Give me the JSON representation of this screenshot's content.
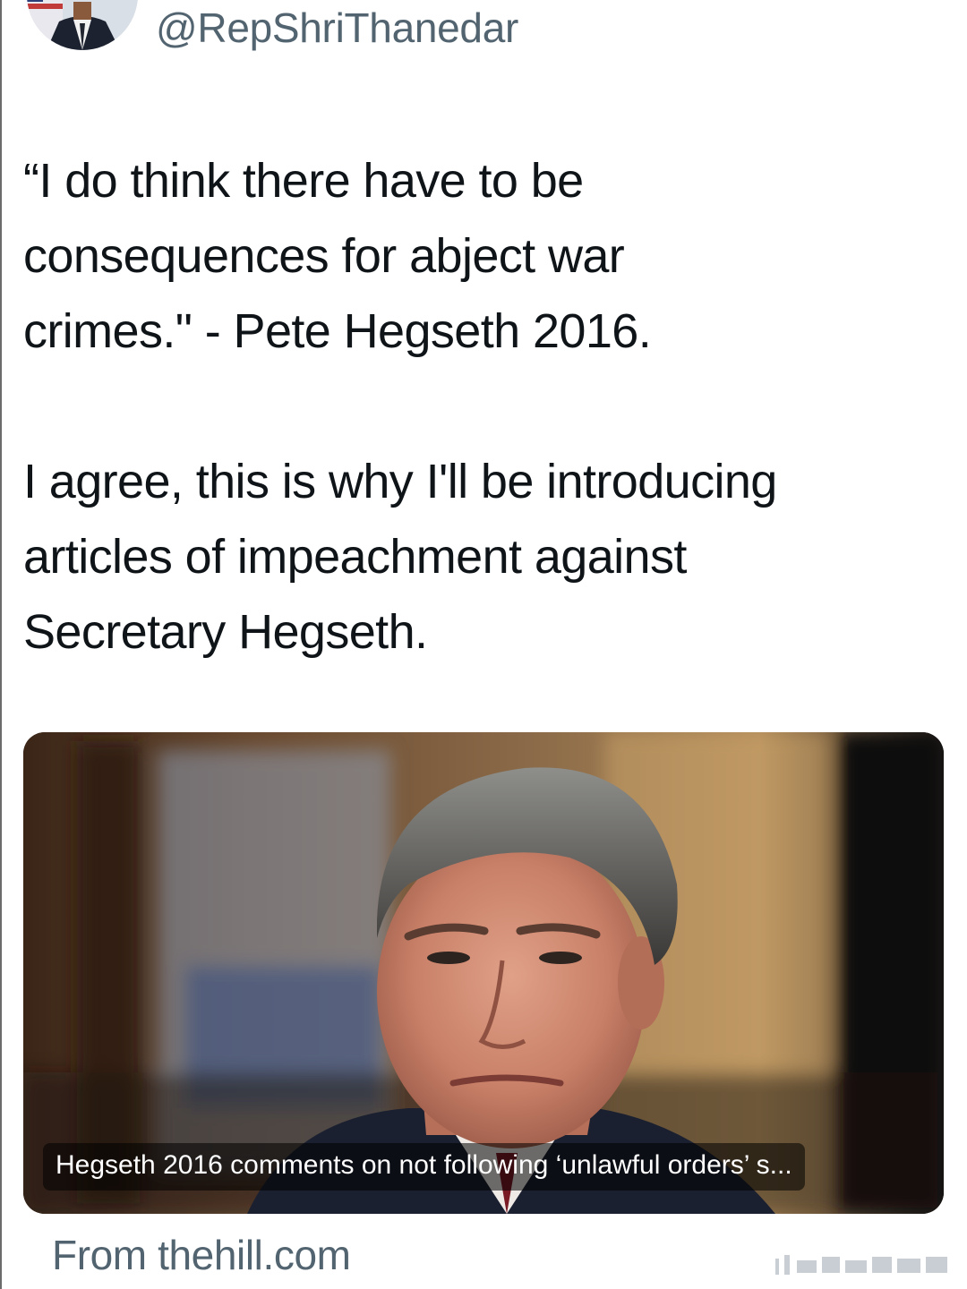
{
  "author": {
    "handle": "@RepShriThanedar",
    "avatar_icon": "profile-photo-avatar"
  },
  "tweet": {
    "paragraphs": [
      "“I do think there have to be\nconsequences for abject war\ncrimes.\" - Pete Hegseth 2016.",
      "I agree, this is why I'll be introducing\narticles of impeachment against\nSecretary Hegseth."
    ]
  },
  "link_card": {
    "image_icon": "news-photo-hegseth",
    "caption": "Hegseth 2016 comments on not following ‘unlawful orders’ s...",
    "source": "From thehill.com"
  },
  "colors": {
    "text_primary": "#0f1419",
    "text_secondary": "#536471",
    "background": "#ffffff"
  }
}
